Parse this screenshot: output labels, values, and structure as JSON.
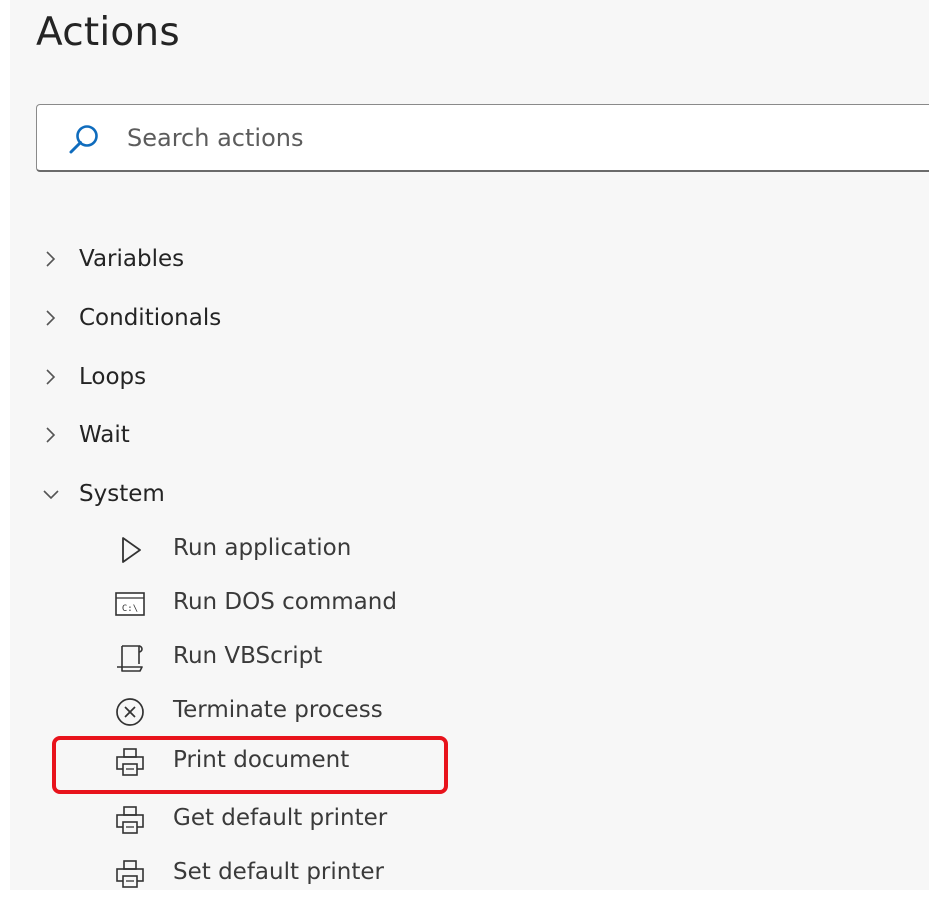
{
  "header": {
    "title": "Actions"
  },
  "search": {
    "placeholder": "Search actions",
    "value": ""
  },
  "groups": [
    {
      "label": "Variables",
      "expanded": false
    },
    {
      "label": "Conditionals",
      "expanded": false
    },
    {
      "label": "Loops",
      "expanded": false
    },
    {
      "label": "Wait",
      "expanded": false
    },
    {
      "label": "System",
      "expanded": true
    }
  ],
  "system_actions": [
    {
      "label": "Run application",
      "icon": "play-icon"
    },
    {
      "label": "Run DOS command",
      "icon": "dos-command-icon"
    },
    {
      "label": "Run VBScript",
      "icon": "script-icon"
    },
    {
      "label": "Terminate process",
      "icon": "close-circle-icon"
    },
    {
      "label": "Print document",
      "icon": "printer-icon",
      "highlighted": true
    },
    {
      "label": "Get default printer",
      "icon": "printer-icon"
    },
    {
      "label": "Set default printer",
      "icon": "printer-icon"
    }
  ],
  "colors": {
    "accent": "#0f6cbd",
    "highlight_border": "#e8131c",
    "panel_background": "#f7f7f7"
  },
  "icons": {
    "dos_icon_text": "C:\\"
  }
}
